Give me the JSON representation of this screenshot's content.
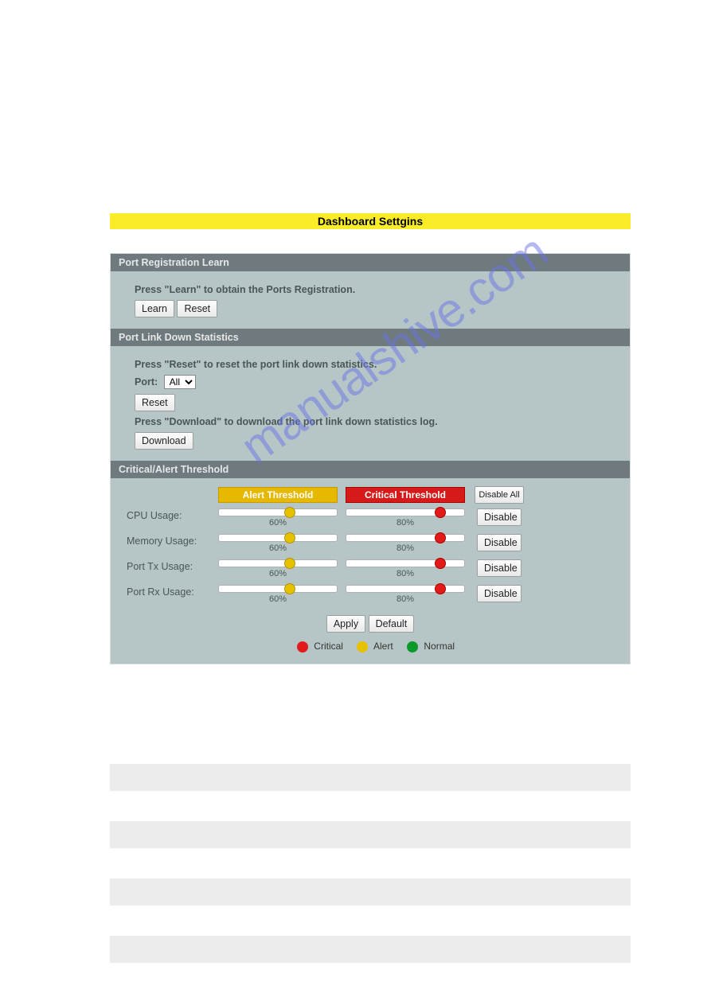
{
  "title": "Dashboard Settgins",
  "watermark": "manualshive.com",
  "sections": {
    "port_reg": {
      "header": "Port Registration Learn",
      "instr": "Press \"Learn\" to obtain the Ports Registration.",
      "learn_btn": "Learn",
      "reset_btn": "Reset"
    },
    "port_link": {
      "header": "Port Link Down Statistics",
      "instr_reset": "Press \"Reset\" to reset the port link down statistics.",
      "port_label": "Port:",
      "port_select_value": "All",
      "reset_btn": "Reset",
      "instr_dl": "Press \"Download\" to download the port link down statistics log.",
      "download_btn": "Download"
    },
    "threshold": {
      "header": "Critical/Alert Threshold",
      "col_alert": "Alert Threshold",
      "col_critical": "Critical Threshold",
      "disable_all_btn": "Disable All",
      "disable_btn": "Disable",
      "apply_btn": "Apply",
      "default_btn": "Default",
      "legend": {
        "critical": "Critical",
        "alert": "Alert",
        "normal": "Normal"
      },
      "rows": [
        {
          "label": "CPU Usage:",
          "alert": 60,
          "critical": 80
        },
        {
          "label": "Memory Usage:",
          "alert": 60,
          "critical": 80
        },
        {
          "label": "Port Tx Usage:",
          "alert": 60,
          "critical": 80
        },
        {
          "label": "Port Rx Usage:",
          "alert": 60,
          "critical": 80
        }
      ]
    }
  },
  "colors": {
    "title_bg": "#faed27",
    "panel_bg": "#b6c6c6",
    "section_hdr_bg": "#6e7a7e",
    "alert": "#e6c100",
    "critical": "#e21a1a",
    "normal": "#0a9a2a"
  }
}
